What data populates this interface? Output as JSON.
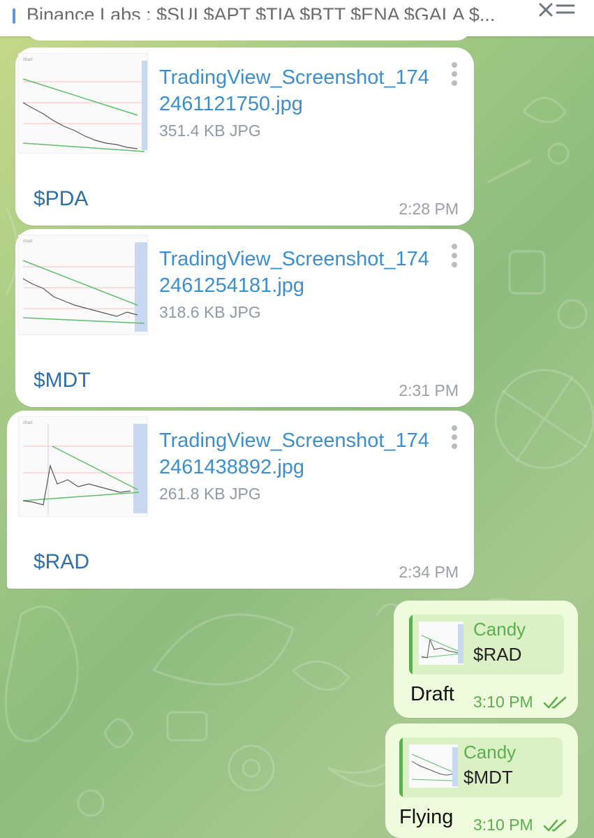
{
  "pinned": {
    "text": "Binance Labs :  $SUI $APT $TIA $BTT $ENA $GALA $..."
  },
  "messages": [
    {
      "file_name": "TradingView_Screenshot_1742461121750.jpg",
      "file_size": "351.4 KB JPG",
      "caption": "$PDA",
      "time": "2:28 PM"
    },
    {
      "file_name": "TradingView_Screenshot_1742461254181.jpg",
      "file_size": "318.6 KB JPG",
      "caption": "$MDT",
      "time": "2:31 PM"
    },
    {
      "file_name": "TradingView_Screenshot_1742461438892.jpg",
      "file_size": "261.8 KB JPG",
      "caption": "$RAD",
      "time": "2:34 PM"
    }
  ],
  "replies": [
    {
      "quote_name": "Candy",
      "quote_text": "$RAD",
      "text": "Draft",
      "time": "3:10 PM"
    },
    {
      "quote_name": "Candy",
      "quote_text": "$MDT",
      "text": "Flying",
      "time": "3:10 PM"
    }
  ],
  "colors": {
    "link": "#3d8ecb",
    "caption": "#2f6fa7",
    "accent_green": "#5cae4e",
    "out_bubble": "#eefbdc"
  },
  "icons": {
    "pinned_list": "pinned-list-icon",
    "menu": "more-vert-icon",
    "read": "double-check-icon"
  }
}
